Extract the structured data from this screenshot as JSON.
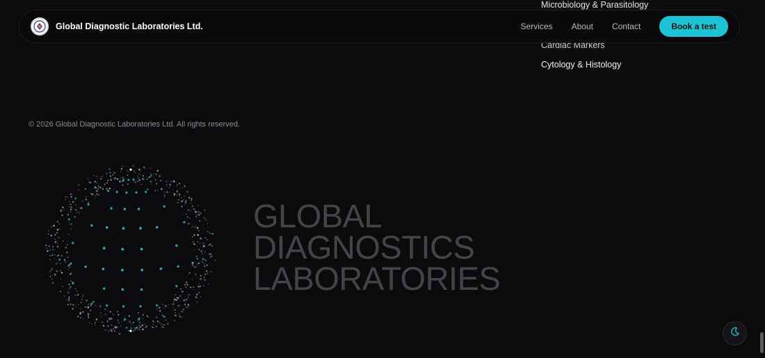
{
  "header": {
    "brand_name": "Global Diagnostic Laboratories Ltd.",
    "nav": [
      {
        "label": "Services"
      },
      {
        "label": "About"
      },
      {
        "label": "Contact"
      }
    ],
    "cta_label": "Book a test"
  },
  "footer": {
    "service_links": [
      "Microbiology & Parasitology",
      "Cardiac Markers",
      "Cytology & Histology"
    ],
    "copyright": "© 2026 Global Diagnostic Laboratories Ltd. All rights reserved."
  },
  "hero": {
    "title_lines": [
      "GLOBAL",
      "DIAGNOSTICS",
      "LABORATORIES"
    ]
  },
  "icons": {
    "brand_logo": "lab-logo-icon",
    "theme_toggle": "moon-icon",
    "globe": "dotted-globe-graphic"
  },
  "colors": {
    "accent": "#1cc3d4",
    "background": "#0b0a0c",
    "title_text": "#444448",
    "globe_dots": "#1fb8c8"
  }
}
